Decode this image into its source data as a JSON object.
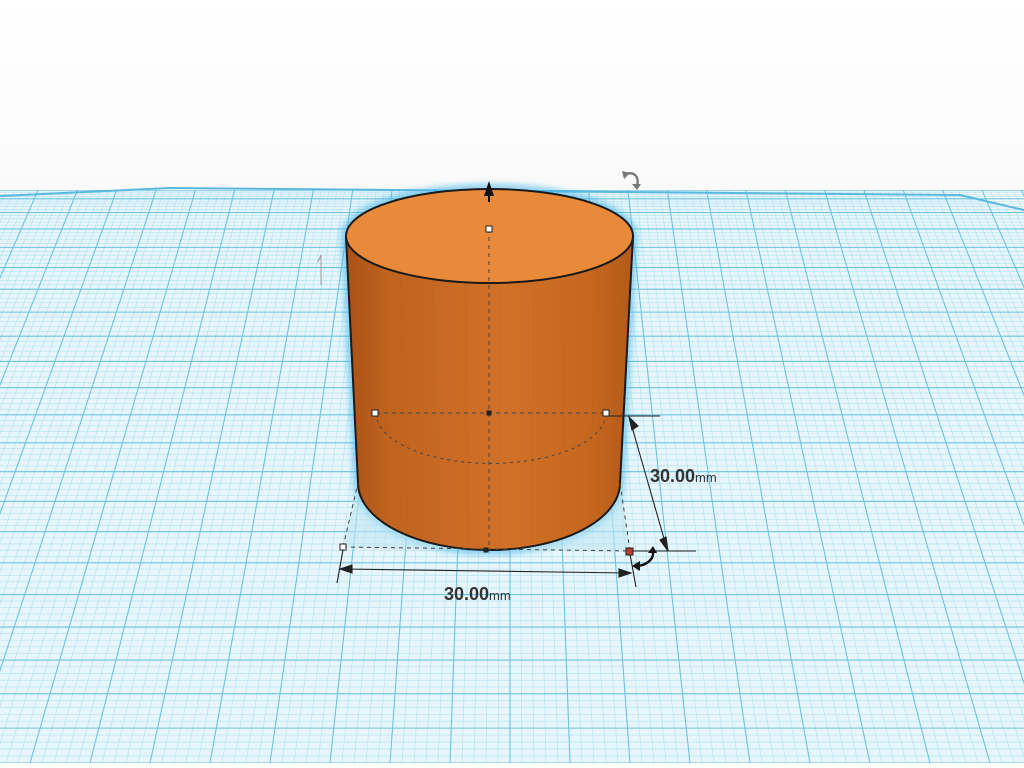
{
  "workplane": {
    "grid_color": "#8fd0ea",
    "plane_color": "#e6f6fc"
  },
  "shape": {
    "type": "cylinder",
    "color": "#e88a3a"
  },
  "dimensions": {
    "width": {
      "value": "30.00",
      "unit": "mm"
    },
    "depth": {
      "value": "30.00",
      "unit": "mm"
    }
  },
  "icons": {
    "lift": "up-arrow-handle-icon",
    "rotate_top": "rotate-arrow-icon",
    "rotate_base": "rotate-arrow-icon"
  }
}
